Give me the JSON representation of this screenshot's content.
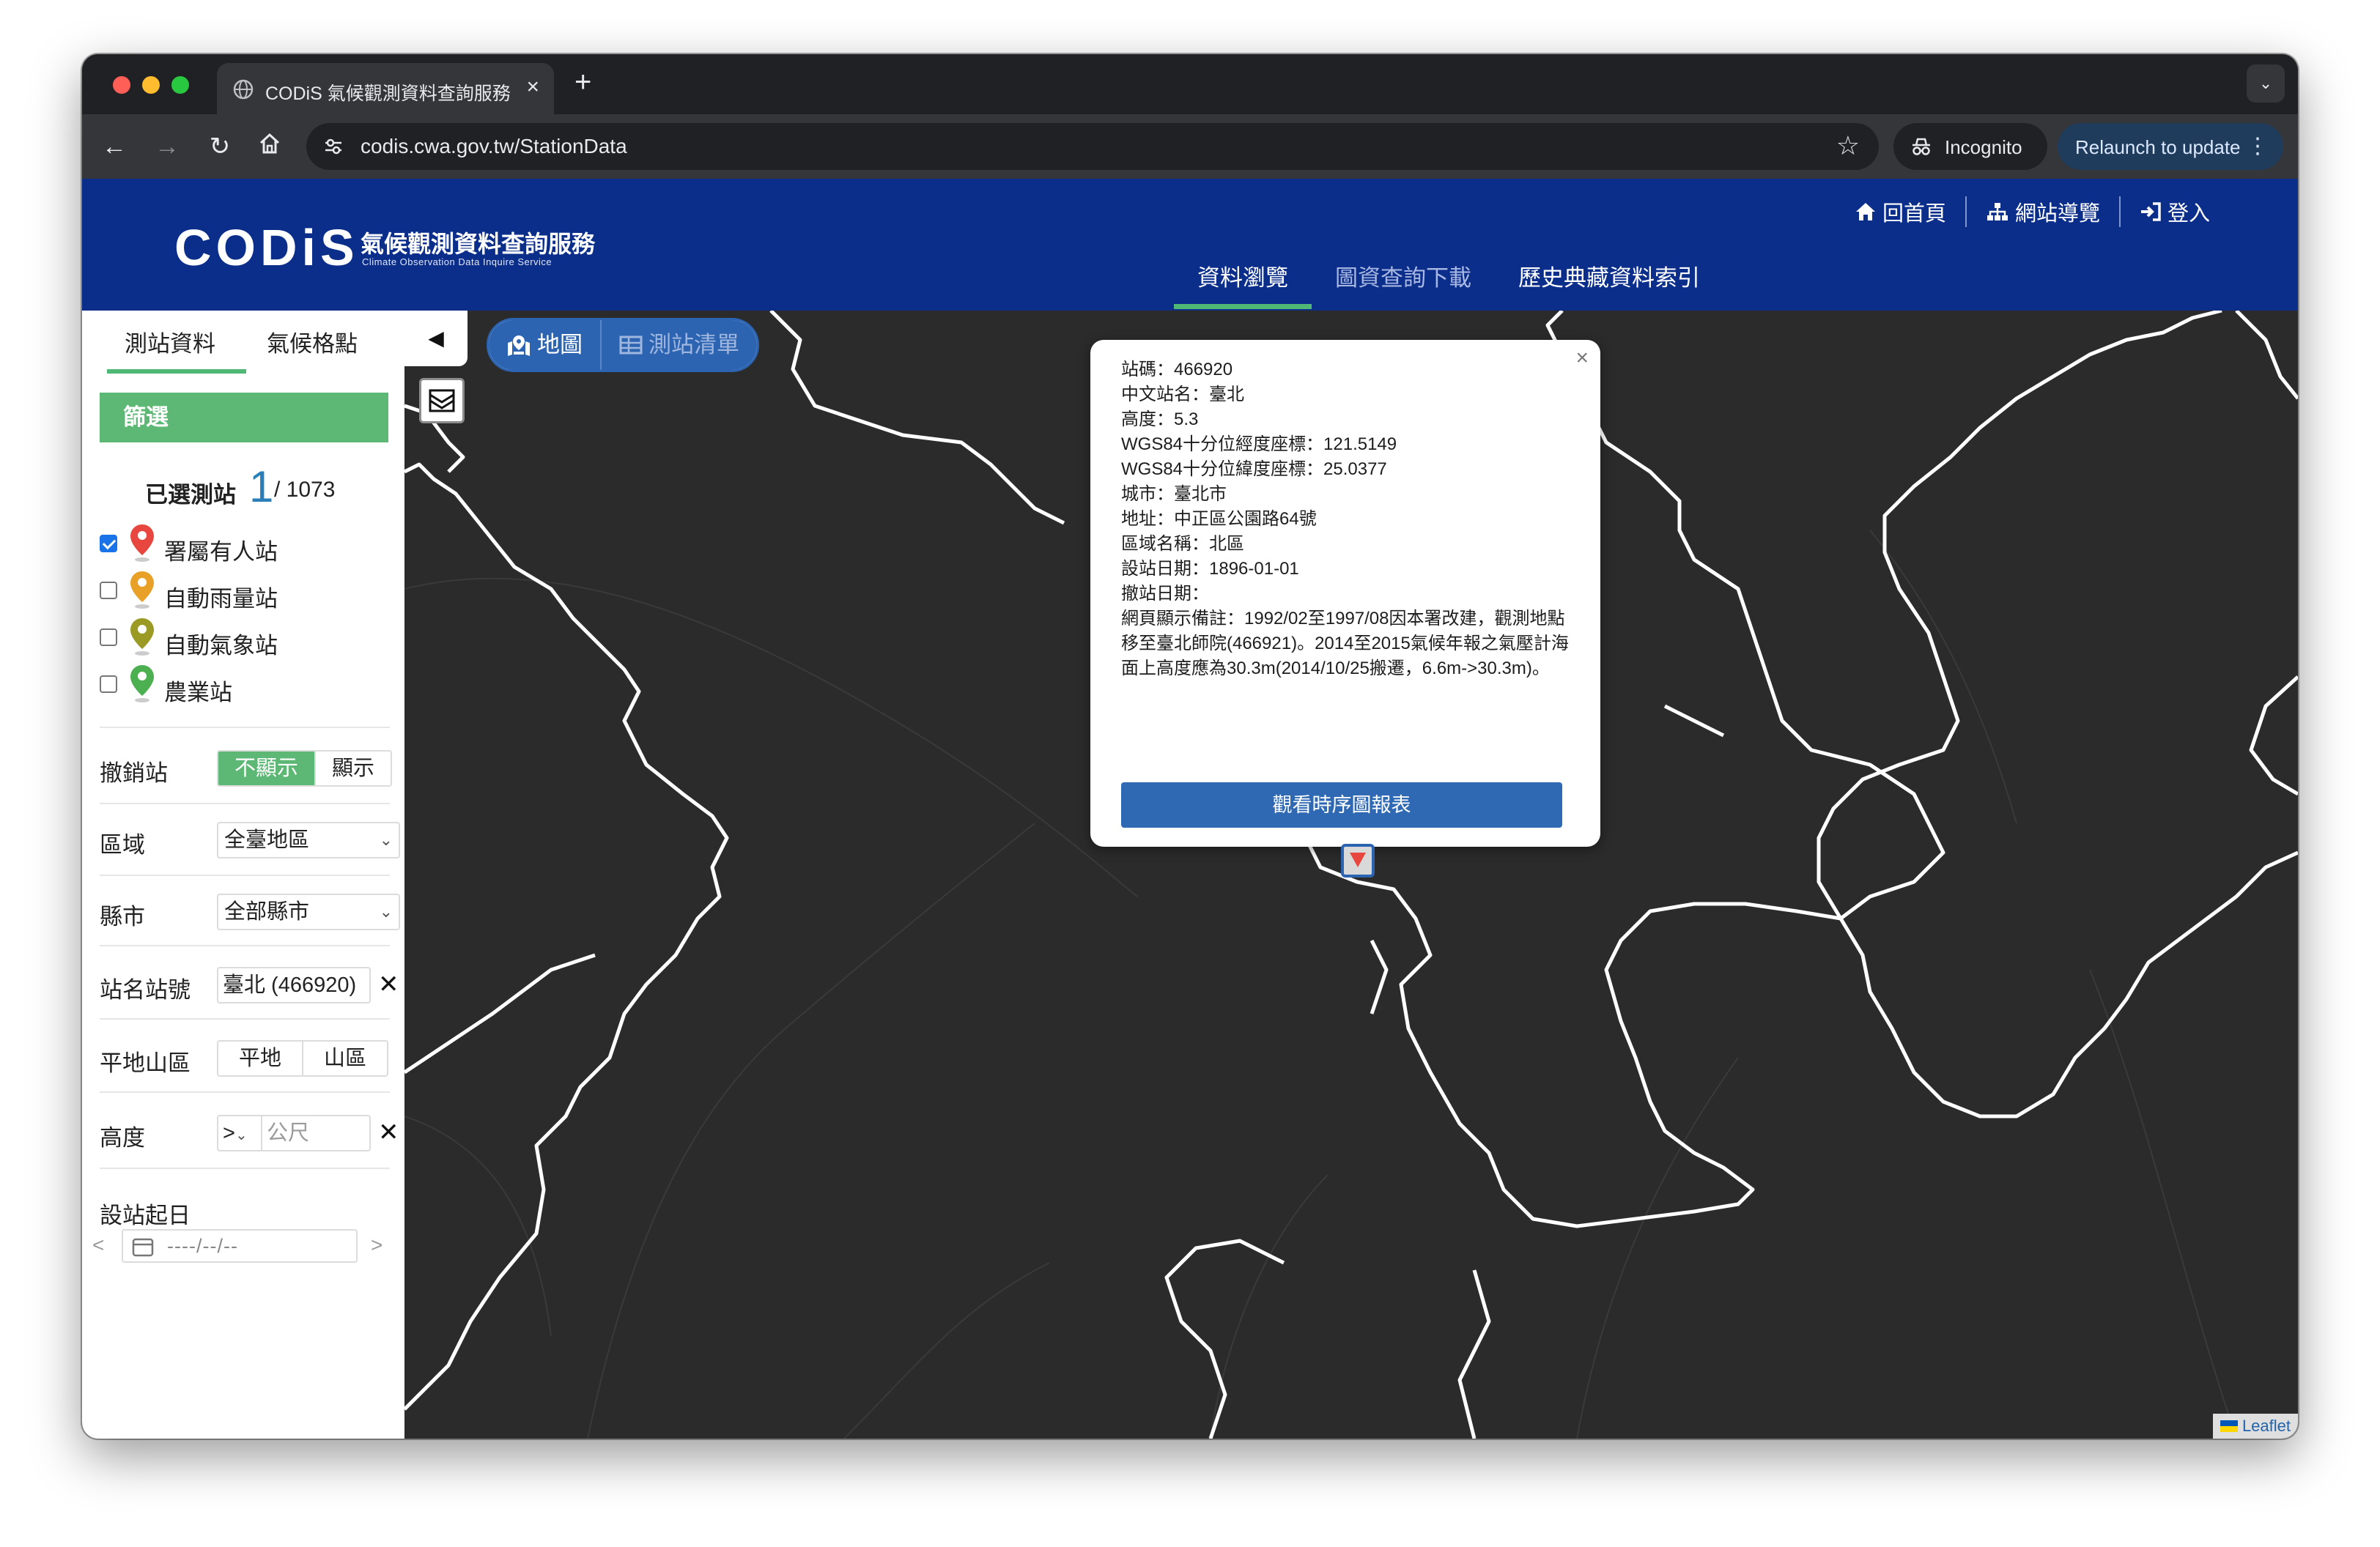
{
  "browser": {
    "tab_title": "CODiS 氣候觀測資料查詢服務",
    "tab_close": "×",
    "new_tab": "+",
    "url": "codis.cwa.gov.tw/StationData",
    "incognito_label": "Incognito",
    "relaunch_label": "Relaunch to update"
  },
  "header": {
    "logo_word": "CODiS",
    "logo_zh": "氣候觀測資料查詢服務",
    "logo_en": "Climate Observation Data Inquire Service",
    "top_links": [
      "回首頁",
      "網站導覽",
      "登入"
    ],
    "main_nav": [
      "資料瀏覽",
      "圖資查詢下載",
      "歷史典藏資料索引"
    ]
  },
  "sidebar": {
    "tabs": [
      "測站資料",
      "氣候格點"
    ],
    "filter_title": "篩選",
    "selected_label": "已選測站",
    "selected_count": "1",
    "total": "/ 1073",
    "station_types": [
      {
        "label": "署屬有人站",
        "checked": true,
        "color": "#e8473f"
      },
      {
        "label": "自動雨量站",
        "checked": false,
        "color": "#e8a126"
      },
      {
        "label": "自動氣象站",
        "checked": false,
        "color": "#9a9a25"
      },
      {
        "label": "農業站",
        "checked": false,
        "color": "#4caf50"
      }
    ],
    "revoked": {
      "label": "撤銷站",
      "options": [
        "不顯示",
        "顯示"
      ],
      "selected": "不顯示"
    },
    "region": {
      "label": "區域",
      "value": "全臺地區"
    },
    "county": {
      "label": "縣市",
      "value": "全部縣市"
    },
    "station_name": {
      "label": "站名站號",
      "value": "臺北 (466920)"
    },
    "terrain": {
      "label": "平地山區",
      "options": [
        "平地",
        "山區"
      ]
    },
    "altitude": {
      "label": "高度",
      "operator": ">",
      "placeholder": "公尺"
    },
    "start_date": {
      "label": "設站起日",
      "placeholder": "----/--/--",
      "prev": "<",
      "next": ">"
    }
  },
  "map": {
    "view_toggle": [
      "地圖",
      "測站清單"
    ],
    "popup": {
      "lines": [
        "站碼：466920",
        "中文站名：臺北",
        "高度：5.3",
        "WGS84十分位經度座標：121.5149",
        "WGS84十分位緯度座標：25.0377",
        "城市：臺北市",
        "地址：中正區公園路64號",
        "區域名稱：北區",
        "設站日期：1896-01-01",
        "撤站日期："
      ],
      "note": "網頁顯示備註：1992/02至1997/08因本署改建，觀測地點移至臺北師院(466921)。2014至2015氣候年報之氣壓計海面上高度應為30.3m(2014/10/25搬遷，6.6m->30.3m)。",
      "button": "觀看時序圖報表",
      "close": "×"
    },
    "attribution": "Leaflet"
  }
}
